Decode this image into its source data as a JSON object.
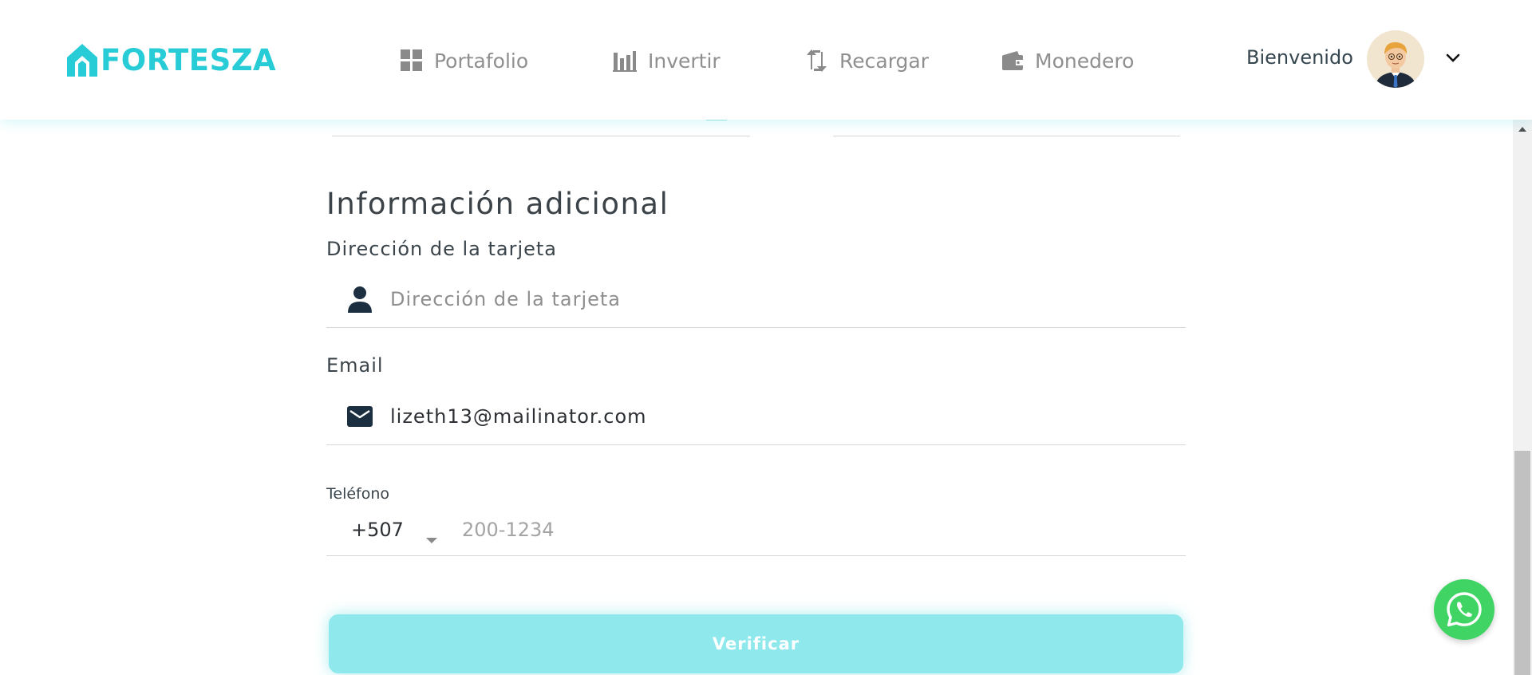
{
  "header": {
    "brand": "FORTESZA",
    "nav": [
      {
        "label": "Portafolio",
        "icon": "dashboard-icon"
      },
      {
        "label": "Invertir",
        "icon": "bar-chart-icon"
      },
      {
        "label": "Recargar",
        "icon": "transfer-icon"
      },
      {
        "label": "Monedero",
        "icon": "wallet-icon"
      }
    ],
    "welcome": "Bienvenido",
    "avatar_icon": "user-avatar",
    "menu_icon": "chevron-down-icon"
  },
  "form": {
    "section_title": "Información adicional",
    "address": {
      "label": "Dirección de la tarjeta",
      "placeholder": "Dirección de la tarjeta",
      "value": "",
      "icon": "person-icon"
    },
    "email": {
      "label": "Email",
      "value": "lizeth13@mailinator.com",
      "icon": "mail-icon"
    },
    "phone": {
      "label": "Teléfono",
      "country_code": "+507",
      "placeholder": "200-1234",
      "value": ""
    },
    "submit_label": "Verificar"
  },
  "colors": {
    "brand": "#27ccd6",
    "button": "#8fe9ec",
    "whatsapp": "#3fd463"
  },
  "floating": {
    "whatsapp_icon": "whatsapp-icon"
  }
}
